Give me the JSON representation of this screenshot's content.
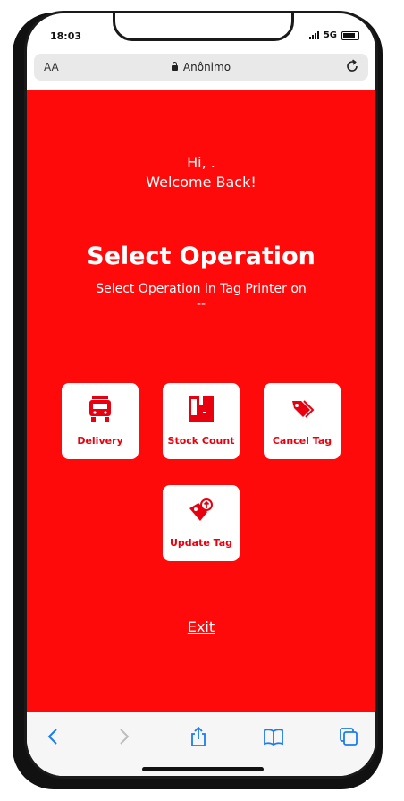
{
  "status_bar": {
    "time": "18:03",
    "network": "5G"
  },
  "browser": {
    "text_size": "AA",
    "address": "Anônimo"
  },
  "greeting": {
    "hi": "Hi, .",
    "welcome": "Welcome Back!"
  },
  "page": {
    "title": "Select Operation",
    "subtitle": "Select Operation in Tag Printer on",
    "printer": "--"
  },
  "operations": [
    {
      "label": "Delivery",
      "icon": "truck-icon"
    },
    {
      "label": "Stock Count",
      "icon": "box-icon"
    },
    {
      "label": "Cancel Tag",
      "icon": "tags-icon"
    },
    {
      "label": "Update Tag",
      "icon": "tag-update-icon"
    }
  ],
  "exit_label": "Exit",
  "colors": {
    "background": "#ff0a0a",
    "accent": "#e8000f",
    "toolbar_icon": "#1a7cf0"
  }
}
